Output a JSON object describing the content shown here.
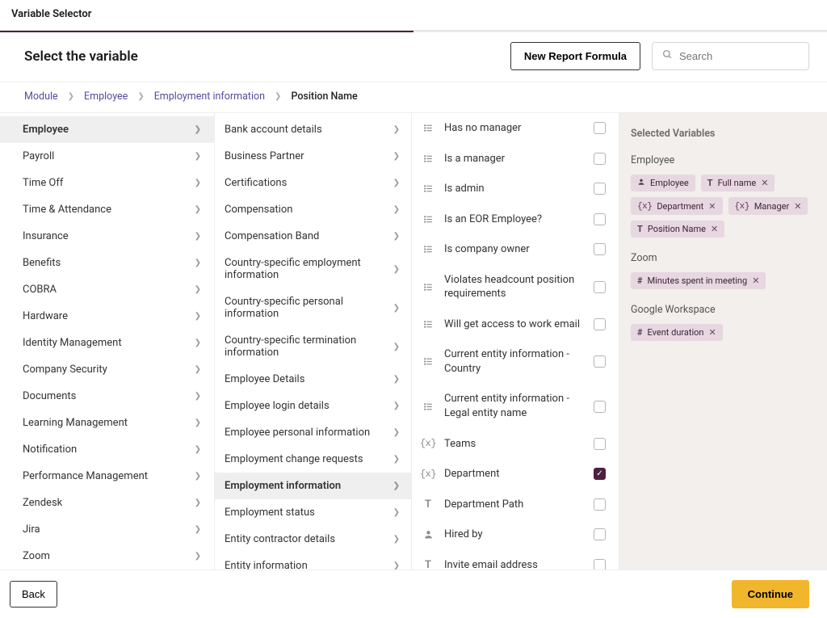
{
  "window_title": "Variable Selector",
  "header": {
    "title": "Select the variable",
    "new_formula_label": "New Report Formula",
    "search_placeholder": "Search"
  },
  "breadcrumbs": [
    {
      "label": "Module",
      "link": true
    },
    {
      "label": "Employee",
      "link": true
    },
    {
      "label": "Employment information",
      "link": true
    },
    {
      "label": "Position Name",
      "link": false
    }
  ],
  "col1": [
    {
      "label": "Employee",
      "selected": true
    },
    {
      "label": "Payroll"
    },
    {
      "label": "Time Off"
    },
    {
      "label": "Time & Attendance"
    },
    {
      "label": "Insurance"
    },
    {
      "label": "Benefits"
    },
    {
      "label": "COBRA"
    },
    {
      "label": "Hardware"
    },
    {
      "label": "Identity Management"
    },
    {
      "label": "Company Security"
    },
    {
      "label": "Documents"
    },
    {
      "label": "Learning Management"
    },
    {
      "label": "Notification"
    },
    {
      "label": "Performance Management"
    },
    {
      "label": "Zendesk"
    },
    {
      "label": "Jira"
    },
    {
      "label": "Zoom"
    }
  ],
  "col2": [
    {
      "label": "Bank account details"
    },
    {
      "label": "Business Partner"
    },
    {
      "label": "Certifications"
    },
    {
      "label": "Compensation"
    },
    {
      "label": "Compensation Band"
    },
    {
      "label": "Country-specific employment information"
    },
    {
      "label": "Country-specific personal information"
    },
    {
      "label": "Country-specific termination information"
    },
    {
      "label": "Employee Details"
    },
    {
      "label": "Employee login details"
    },
    {
      "label": "Employee personal information"
    },
    {
      "label": "Employment change requests"
    },
    {
      "label": "Employment information",
      "selected": true
    },
    {
      "label": "Employment status"
    },
    {
      "label": "Entity contractor details"
    },
    {
      "label": "Entity information"
    }
  ],
  "col3": [
    {
      "type": "list",
      "label": "Has no manager"
    },
    {
      "type": "list",
      "label": "Is a manager"
    },
    {
      "type": "list",
      "label": "Is admin"
    },
    {
      "type": "list",
      "label": "Is an EOR Employee?"
    },
    {
      "type": "list",
      "label": "Is company owner"
    },
    {
      "type": "list",
      "label": "Violates headcount position requirements"
    },
    {
      "type": "list",
      "label": "Will get access to work email"
    },
    {
      "type": "list",
      "label": "Current entity information - Country"
    },
    {
      "type": "list",
      "label": "Current entity information - Legal entity name"
    },
    {
      "type": "var",
      "label": "Teams"
    },
    {
      "type": "var",
      "label": "Department",
      "checked": true
    },
    {
      "type": "text",
      "label": "Department Path"
    },
    {
      "type": "person",
      "label": "Hired by"
    },
    {
      "type": "text",
      "label": "Invite email address"
    }
  ],
  "selected_panel": {
    "title": "Selected Variables",
    "groups": [
      {
        "name": "Employee",
        "chips": [
          {
            "icon": "person",
            "label": "Employee",
            "removable": false
          },
          {
            "icon": "text",
            "label": "Full name",
            "removable": true
          },
          {
            "icon": "var",
            "label": "Department",
            "removable": true
          },
          {
            "icon": "var",
            "label": "Manager",
            "removable": true
          },
          {
            "icon": "text",
            "label": "Position Name",
            "removable": true
          }
        ]
      },
      {
        "name": "Zoom",
        "chips": [
          {
            "icon": "hash",
            "label": "Minutes spent in meeting",
            "removable": true
          }
        ]
      },
      {
        "name": "Google Workspace",
        "chips": [
          {
            "icon": "hash",
            "label": "Event duration",
            "removable": true
          }
        ]
      }
    ]
  },
  "footer": {
    "back": "Back",
    "continue": "Continue"
  }
}
